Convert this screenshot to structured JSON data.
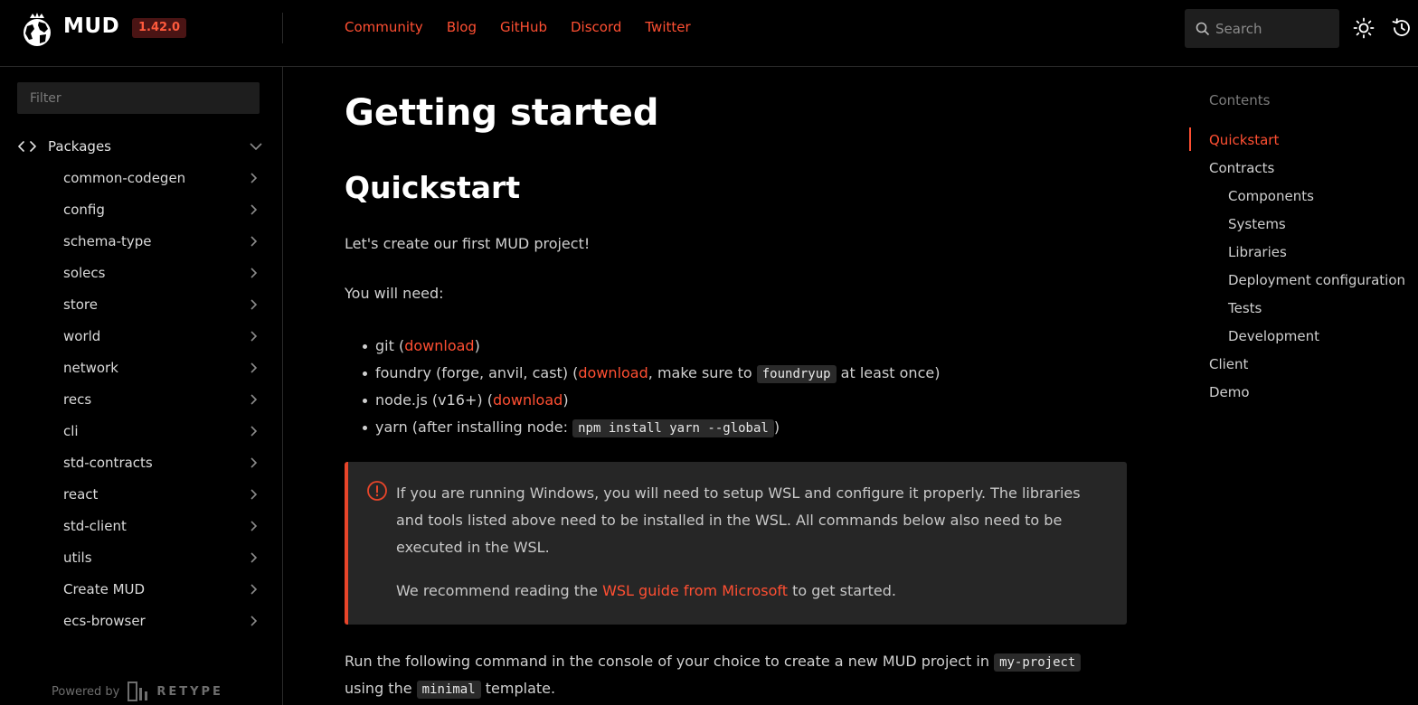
{
  "header": {
    "brand": "MUD",
    "version": "1.42.0",
    "nav": [
      "Community",
      "Blog",
      "GitHub",
      "Discord",
      "Twitter"
    ],
    "search_placeholder": "Search",
    "icons": [
      "search-icon",
      "sun-icon",
      "history-icon"
    ]
  },
  "sidebar": {
    "filter_placeholder": "Filter",
    "section": "Packages",
    "items": [
      "common-codegen",
      "config",
      "schema-type",
      "solecs",
      "store",
      "world",
      "network",
      "recs",
      "cli",
      "std-contracts",
      "react",
      "std-client",
      "utils",
      "Create MUD",
      "ecs-browser"
    ],
    "powered_by": "Powered by",
    "powered_brand": "RETYPE"
  },
  "main": {
    "title": "Getting started",
    "subtitle": "Quickstart",
    "intro": "Let's create our first MUD project!",
    "need": "You will need:",
    "list": {
      "git_prefix": "git (",
      "git_link": "download",
      "git_suffix": ")",
      "foundry_prefix": "foundry (forge, anvil, cast) (",
      "foundry_link": "download",
      "foundry_mid": ", make sure to ",
      "foundry_code": "foundryup",
      "foundry_suffix": " at least once)",
      "node_prefix": "node.js (v16+) (",
      "node_link": "download",
      "node_suffix": ")",
      "yarn_prefix": "yarn (after installing node: ",
      "yarn_code": "npm install yarn --global",
      "yarn_suffix": ")"
    },
    "callout": {
      "text": "If you are running Windows, you will need to setup WSL and configure it properly. The libraries and tools listed above need to be installed in the WSL. All commands below also need to be executed in the WSL.",
      "rec_prefix": "We recommend reading the ",
      "rec_link": "WSL guide from Microsoft",
      "rec_suffix": " to get started."
    },
    "run": {
      "prefix": "Run the following command in the console of your choice to create a new MUD project in ",
      "code1": "my-project",
      "mid": "using the ",
      "code2": "minimal",
      "suffix": " template."
    }
  },
  "toc": {
    "title": "Contents",
    "items": [
      {
        "label": "Quickstart",
        "active": true,
        "indent": 0
      },
      {
        "label": "Contracts",
        "indent": 0
      },
      {
        "label": "Components",
        "indent": 1
      },
      {
        "label": "Systems",
        "indent": 1
      },
      {
        "label": "Libraries",
        "indent": 1
      },
      {
        "label": "Deployment configuration",
        "indent": 1
      },
      {
        "label": "Tests",
        "indent": 1
      },
      {
        "label": "Development",
        "indent": 1
      },
      {
        "label": "Client",
        "indent": 0
      },
      {
        "label": "Demo",
        "indent": 0
      }
    ]
  },
  "colors": {
    "accent": "#ff4f32",
    "background": "#000000",
    "callout_bg": "#262626"
  }
}
